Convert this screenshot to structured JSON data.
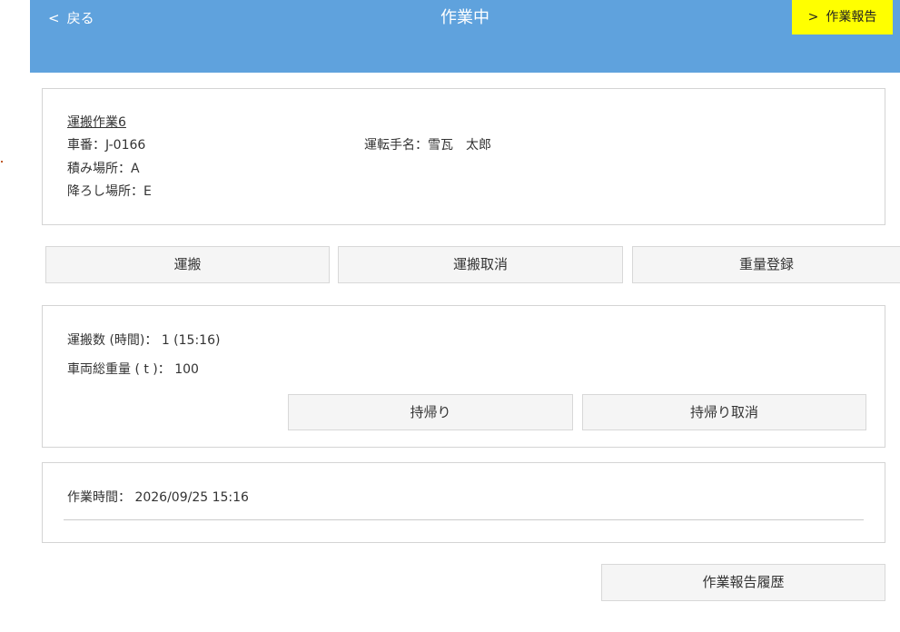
{
  "header": {
    "back_label": "戻る",
    "title": "作業中",
    "report_label": "作業報告",
    "color": "#5fa2dd",
    "report_color": "#ffff00"
  },
  "job": {
    "name": "運搬作業6",
    "vehicle": "車番：J-0166",
    "driver": "運転手名：雪瓦　太郎",
    "load_place": "積み場所：A",
    "unload_place": "降ろし場所：E"
  },
  "actions": {
    "transport": "運搬",
    "transport_cancel": "運搬取消",
    "weight_register": "重量登録"
  },
  "stats": {
    "transport_count": "運搬数 (時間)： 1 (15:16)",
    "total_weight": "車両総重量 ( t )： 100",
    "return_label": "持帰り",
    "return_cancel_label": "持帰り取消"
  },
  "work_time": "作業時間： 2026/09/25 15:16",
  "history_label": "作業報告履歴"
}
